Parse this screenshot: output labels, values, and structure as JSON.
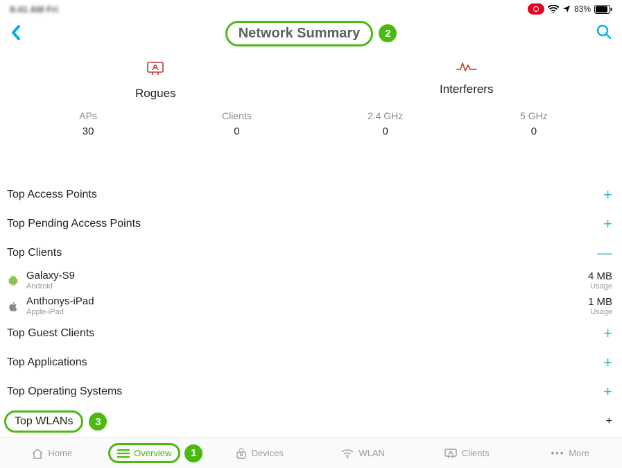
{
  "status": {
    "left_blur": "9:41 AM Fri",
    "battery_pct": "83%"
  },
  "header": {
    "title": "Network Summary"
  },
  "callouts": {
    "title_step": "2",
    "overview_step": "1",
    "wlan_step": "3"
  },
  "summary": {
    "rogues_label": "Rogues",
    "interferers_label": "Interferers"
  },
  "stats": {
    "aps_label": "APs",
    "aps_value": "30",
    "clients_label": "Clients",
    "clients_value": "0",
    "g24_label": "2.4 GHz",
    "g24_value": "0",
    "g5_label": "5 GHz",
    "g5_value": "0"
  },
  "sections": {
    "top_aps": "Top Access Points",
    "top_pending_aps": "Top Pending Access Points",
    "top_clients": "Top Clients",
    "top_guest_clients": "Top Guest Clients",
    "top_applications": "Top Applications",
    "top_os": "Top Operating Systems",
    "top_wlans": "Top WLANs"
  },
  "clients": [
    {
      "name": "Galaxy-S9",
      "os": "Android",
      "usage": "4 MB",
      "usage_label": "Usage",
      "icon": "android"
    },
    {
      "name": "Anthonys-iPad",
      "os": "Apple-iPad",
      "usage": "1 MB",
      "usage_label": "Usage",
      "icon": "apple"
    }
  ],
  "tabs": {
    "home": "Home",
    "overview": "Overview",
    "devices": "Devices",
    "wlan": "WLAN",
    "clients": "Clients",
    "more": "More"
  },
  "glyphs": {
    "plus": "+",
    "minus": "—"
  }
}
